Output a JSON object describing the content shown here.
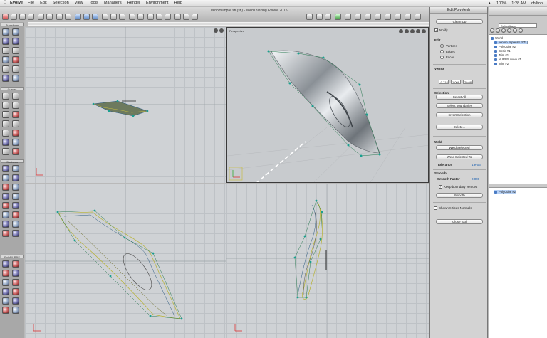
{
  "menubar": {
    "app": "Evolve",
    "menus": [
      "File",
      "Edit",
      "Selection",
      "View",
      "Tools",
      "Managers",
      "Render",
      "Environment",
      "Help"
    ],
    "right_status": "100%",
    "time": "1:28 AM",
    "user": "chilton"
  },
  "window": {
    "title": "venom impre.stl (stl) - solidThinking Evolve 2015"
  },
  "palette": {
    "sections": [
      "Transform",
      "Curves",
      "Surfaces",
      "PolyNURBS"
    ]
  },
  "viewports": {
    "top_right_label": "Perspective"
  },
  "properties": {
    "title": "Edit PolyMesh",
    "clean_up": "Clean Up",
    "notify": "Notify",
    "edit_label": "Edit",
    "edit_modes": [
      "Vertices",
      "Edges",
      "Faces"
    ],
    "vertex_label": "Vertex",
    "vertex_values": [
      "-0.718",
      "1.008",
      "20.08"
    ],
    "selection_label": "Selection",
    "select_all": "Select All",
    "select_boundaries": "Select boundaries",
    "invert_selection": "Invert Selection",
    "delete": "Delete...",
    "weld_label": "Weld",
    "weld_selected": "Weld Selected",
    "weld_selected_to": "Weld Selected To",
    "tolerance_label": "Tolerance",
    "tolerance_value": "1.e-06",
    "smooth_label": "Smooth",
    "smooth_factor_label": "Smooth Factor",
    "smooth_factor_value": "0.000",
    "keep_boundary": "Keep boundary vertices",
    "smooth_button": "Smooth",
    "show_normals": "Show Vertices Normals",
    "close_tool": "Close tool"
  },
  "scene": {
    "layer": "DefaultLayer",
    "tree": [
      "World",
      "venom impre.stl (STL)",
      "PolyCube #2",
      "Circle #1",
      "Trim #1",
      "NURBS curve #1",
      "Trim #2"
    ],
    "lower_item": "PolyCube #2"
  }
}
